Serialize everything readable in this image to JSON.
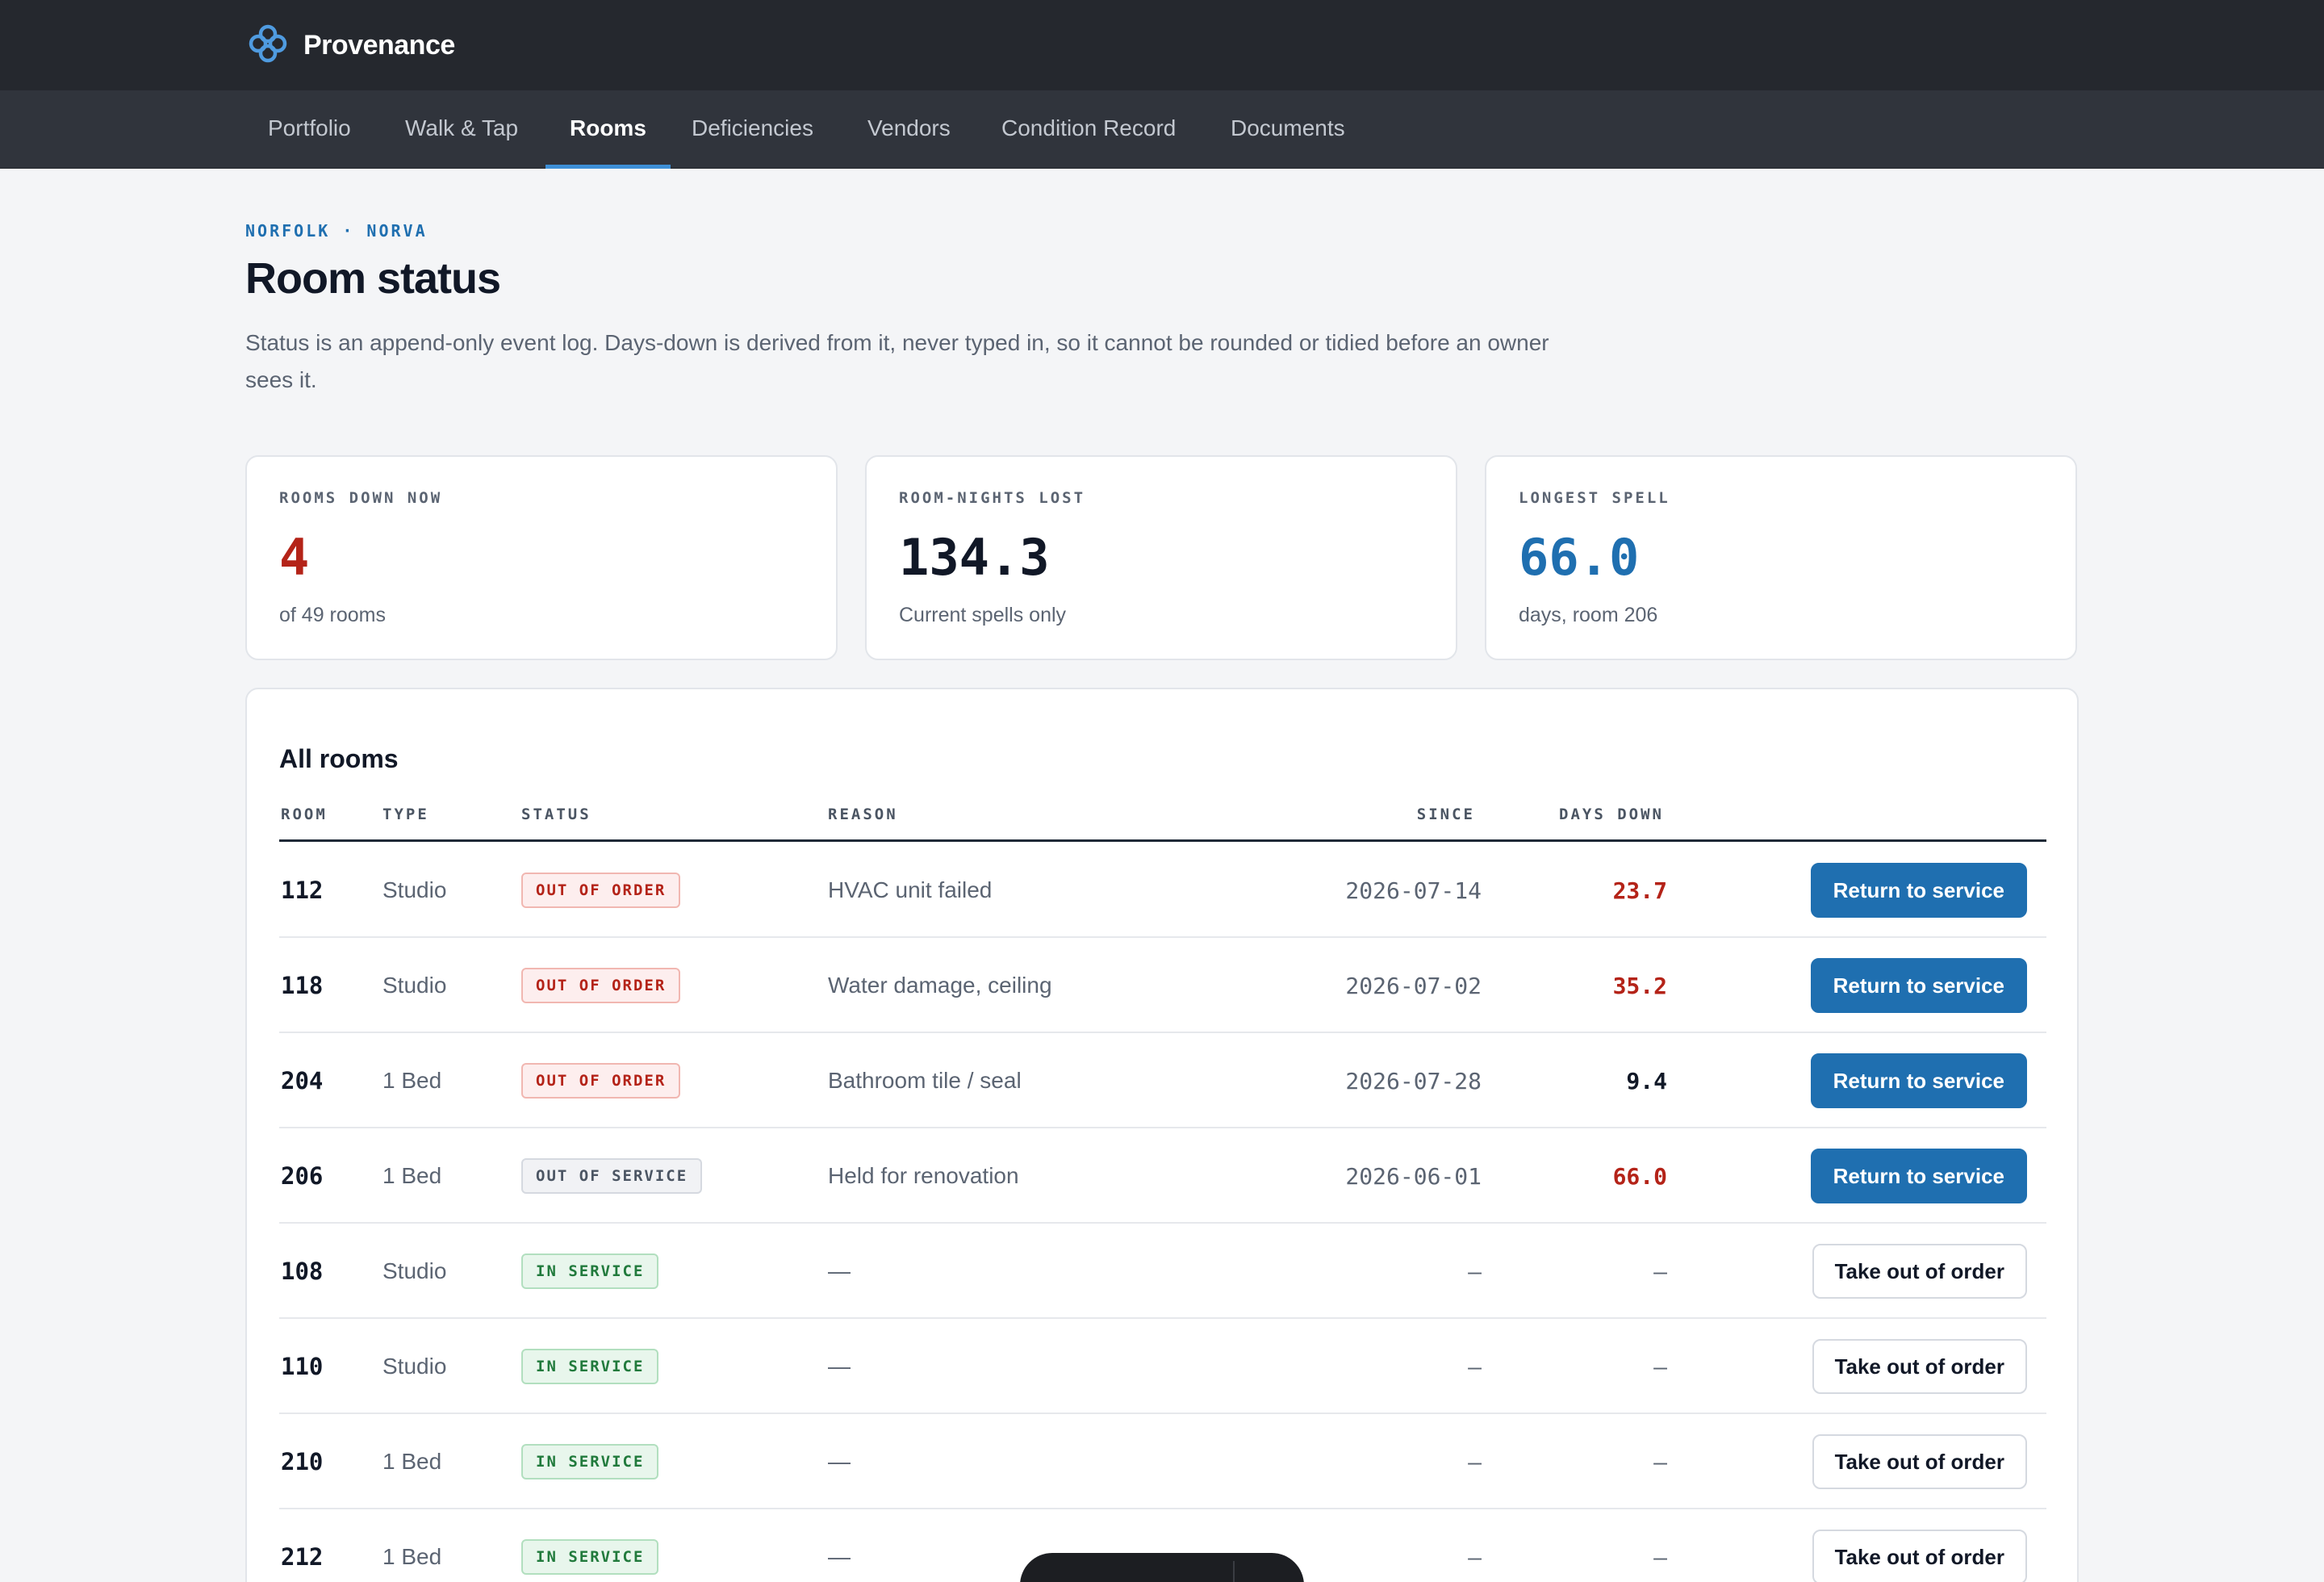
{
  "app": {
    "name": "Provenance",
    "colors": {
      "topbar": "#25282e",
      "navbar": "#30343c",
      "accent": "#1f6fb0",
      "danger": "#b42318",
      "success": "#217a3c"
    }
  },
  "nav": {
    "items": [
      {
        "label": "Portfolio",
        "active": false
      },
      {
        "label": "Walk & Tap",
        "active": false
      },
      {
        "label": "Rooms",
        "active": true
      },
      {
        "label": "Deficiencies",
        "active": false
      },
      {
        "label": "Vendors",
        "active": false
      },
      {
        "label": "Condition Record",
        "active": false
      },
      {
        "label": "Documents",
        "active": false
      }
    ]
  },
  "page": {
    "breadcrumb": "NORFOLK · NORVA",
    "title": "Room status",
    "description": "Status is an append-only event log. Days-down is derived from it, never typed in, so it cannot be rounded or tidied before an owner sees it."
  },
  "stats": [
    {
      "label": "ROOMS DOWN NOW",
      "value": "4",
      "sub": "of 49 rooms",
      "color": "#b42318"
    },
    {
      "label": "ROOM-NIGHTS LOST",
      "value": "134.3",
      "sub": "Current spells only",
      "color": "#111827"
    },
    {
      "label": "LONGEST SPELL",
      "value": "66.0",
      "sub": "days, room 206",
      "color": "#1f6fb0"
    }
  ],
  "table": {
    "title": "All rooms",
    "headers": {
      "room": "ROOM",
      "type": "TYPE",
      "status": "STATUS",
      "reason": "REASON",
      "since": "SINCE",
      "days": "DAYS DOWN"
    },
    "rows": [
      {
        "room": "112",
        "type": "Studio",
        "status": "OUT OF ORDER",
        "status_kind": "ooo",
        "reason": "HVAC unit failed",
        "since": "2026-07-14",
        "days": "23.7",
        "days_kind": "red",
        "action": "Return to service",
        "action_kind": "primary"
      },
      {
        "room": "118",
        "type": "Studio",
        "status": "OUT OF ORDER",
        "status_kind": "ooo",
        "reason": "Water damage, ceiling",
        "since": "2026-07-02",
        "days": "35.2",
        "days_kind": "red",
        "action": "Return to service",
        "action_kind": "primary"
      },
      {
        "room": "204",
        "type": "1 Bed",
        "status": "OUT OF ORDER",
        "status_kind": "ooo",
        "reason": "Bathroom tile / seal",
        "since": "2026-07-28",
        "days": "9.4",
        "days_kind": "dark",
        "action": "Return to service",
        "action_kind": "primary"
      },
      {
        "room": "206",
        "type": "1 Bed",
        "status": "OUT OF SERVICE",
        "status_kind": "oos",
        "reason": "Held for renovation",
        "since": "2026-06-01",
        "days": "66.0",
        "days_kind": "red",
        "action": "Return to service",
        "action_kind": "primary"
      },
      {
        "room": "108",
        "type": "Studio",
        "status": "IN SERVICE",
        "status_kind": "ins",
        "reason": "—",
        "since": "–",
        "days": "–",
        "days_kind": "muted",
        "action": "Take out of order",
        "action_kind": "secondary"
      },
      {
        "room": "110",
        "type": "Studio",
        "status": "IN SERVICE",
        "status_kind": "ins",
        "reason": "—",
        "since": "–",
        "days": "–",
        "days_kind": "muted",
        "action": "Take out of order",
        "action_kind": "secondary"
      },
      {
        "room": "210",
        "type": "1 Bed",
        "status": "IN SERVICE",
        "status_kind": "ins",
        "reason": "—",
        "since": "–",
        "days": "–",
        "days_kind": "muted",
        "action": "Take out of order",
        "action_kind": "secondary"
      },
      {
        "room": "212",
        "type": "1 Bed",
        "status": "IN SERVICE",
        "status_kind": "ins",
        "reason": "—",
        "since": "–",
        "days": "–",
        "days_kind": "muted",
        "action": "Take out of order",
        "action_kind": "secondary"
      }
    ]
  }
}
